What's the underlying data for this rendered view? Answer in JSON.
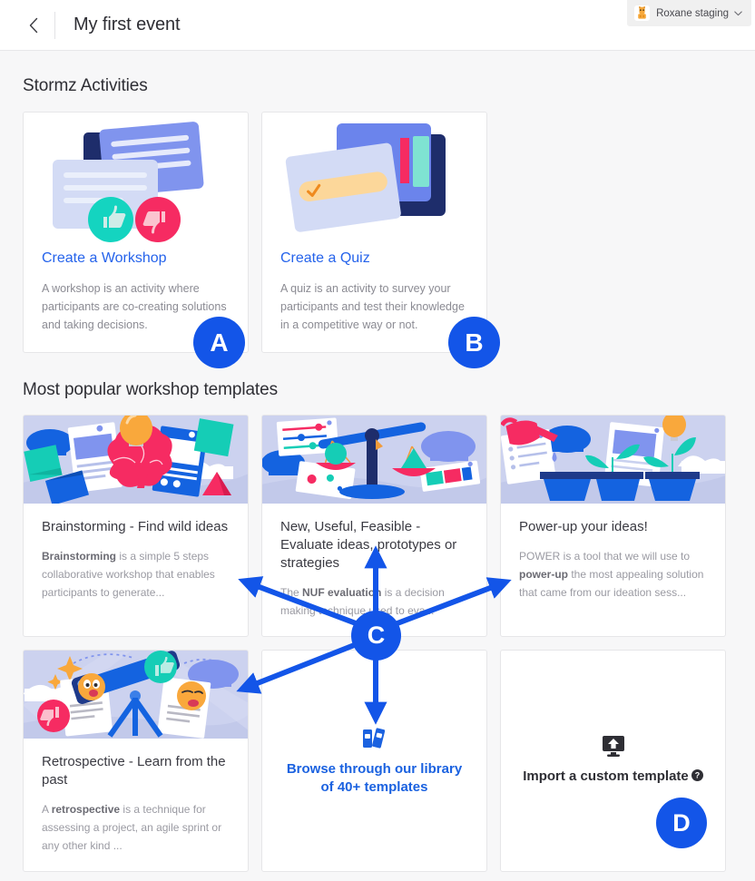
{
  "header": {
    "back_icon": "chevron-left-icon",
    "title": "My first event",
    "workspace": {
      "avatar_icon": "workspace-avatar-icon",
      "avatar_glyph": "🦒",
      "name": "Roxane staging",
      "chevron_icon": "chevron-down-icon",
      "chevron_glyph": "⌄"
    }
  },
  "activities": {
    "section_title": "Stormz Activities",
    "cards": [
      {
        "illustration": "workshop-cards-illustration",
        "link_label": "Create a Workshop",
        "description": "A workshop is an activity where participants are co-creating solutions and taking decisions."
      },
      {
        "illustration": "quiz-cards-illustration",
        "link_label": "Create a Quiz",
        "description": "A quiz is an activity to survey your participants and test their knowledge in a competitive way or not."
      }
    ]
  },
  "templates": {
    "section_title": "Most popular workshop templates",
    "cards": [
      {
        "illustration": "brainstorming-illustration",
        "title": "Brainstorming - Find wild ideas",
        "desc_bold": "Brainstorming",
        "desc_rest": " is a simple 5 steps collaborative workshop that enables participants to generate..."
      },
      {
        "illustration": "nuf-scales-illustration",
        "title": "New, Useful, Feasible - Evaluate ideas, prototypes or strategies",
        "desc_pre": "The ",
        "desc_bold": "NUF evaluation",
        "desc_rest": " is a decision making technique used to eva..."
      },
      {
        "illustration": "power-up-plants-illustration",
        "title": "Power-up your ideas!",
        "desc_pre": "POWER is a tool that we will use to ",
        "desc_bold": "power-up",
        "desc_rest": " the most appealing solution that came from our ideation sess..."
      },
      {
        "illustration": "retrospective-telescope-illustration",
        "title": "Retrospective - Learn from the past",
        "desc_pre": "A ",
        "desc_bold": "retrospective",
        "desc_rest": " is a technique for assessing a project, an agile sprint or any other kind ..."
      }
    ],
    "browse_action": {
      "icon": "library-books-icon",
      "label": "Browse through our library of 40+ templates"
    },
    "import_action": {
      "icon": "import-upload-monitor-icon",
      "label": "Import a custom template",
      "help_icon": "help-circle-icon"
    }
  },
  "annotations": {
    "markers": [
      {
        "id": "A",
        "label": "A"
      },
      {
        "id": "B",
        "label": "B"
      },
      {
        "id": "C",
        "label": "C"
      },
      {
        "id": "D",
        "label": "D"
      }
    ],
    "arrow_color": "#1355e8"
  },
  "colors": {
    "accent_blue": "#1355e8",
    "link_blue": "#2563eb",
    "page_bg": "#f7f7f8",
    "card_bg": "#ffffff",
    "card_border": "#e6e6e8",
    "illustration_bg": "#ccd2ef",
    "text_dark": "#2e2e34",
    "text_muted": "#9a9aa2",
    "badge_bg": "#f0f0f0"
  }
}
